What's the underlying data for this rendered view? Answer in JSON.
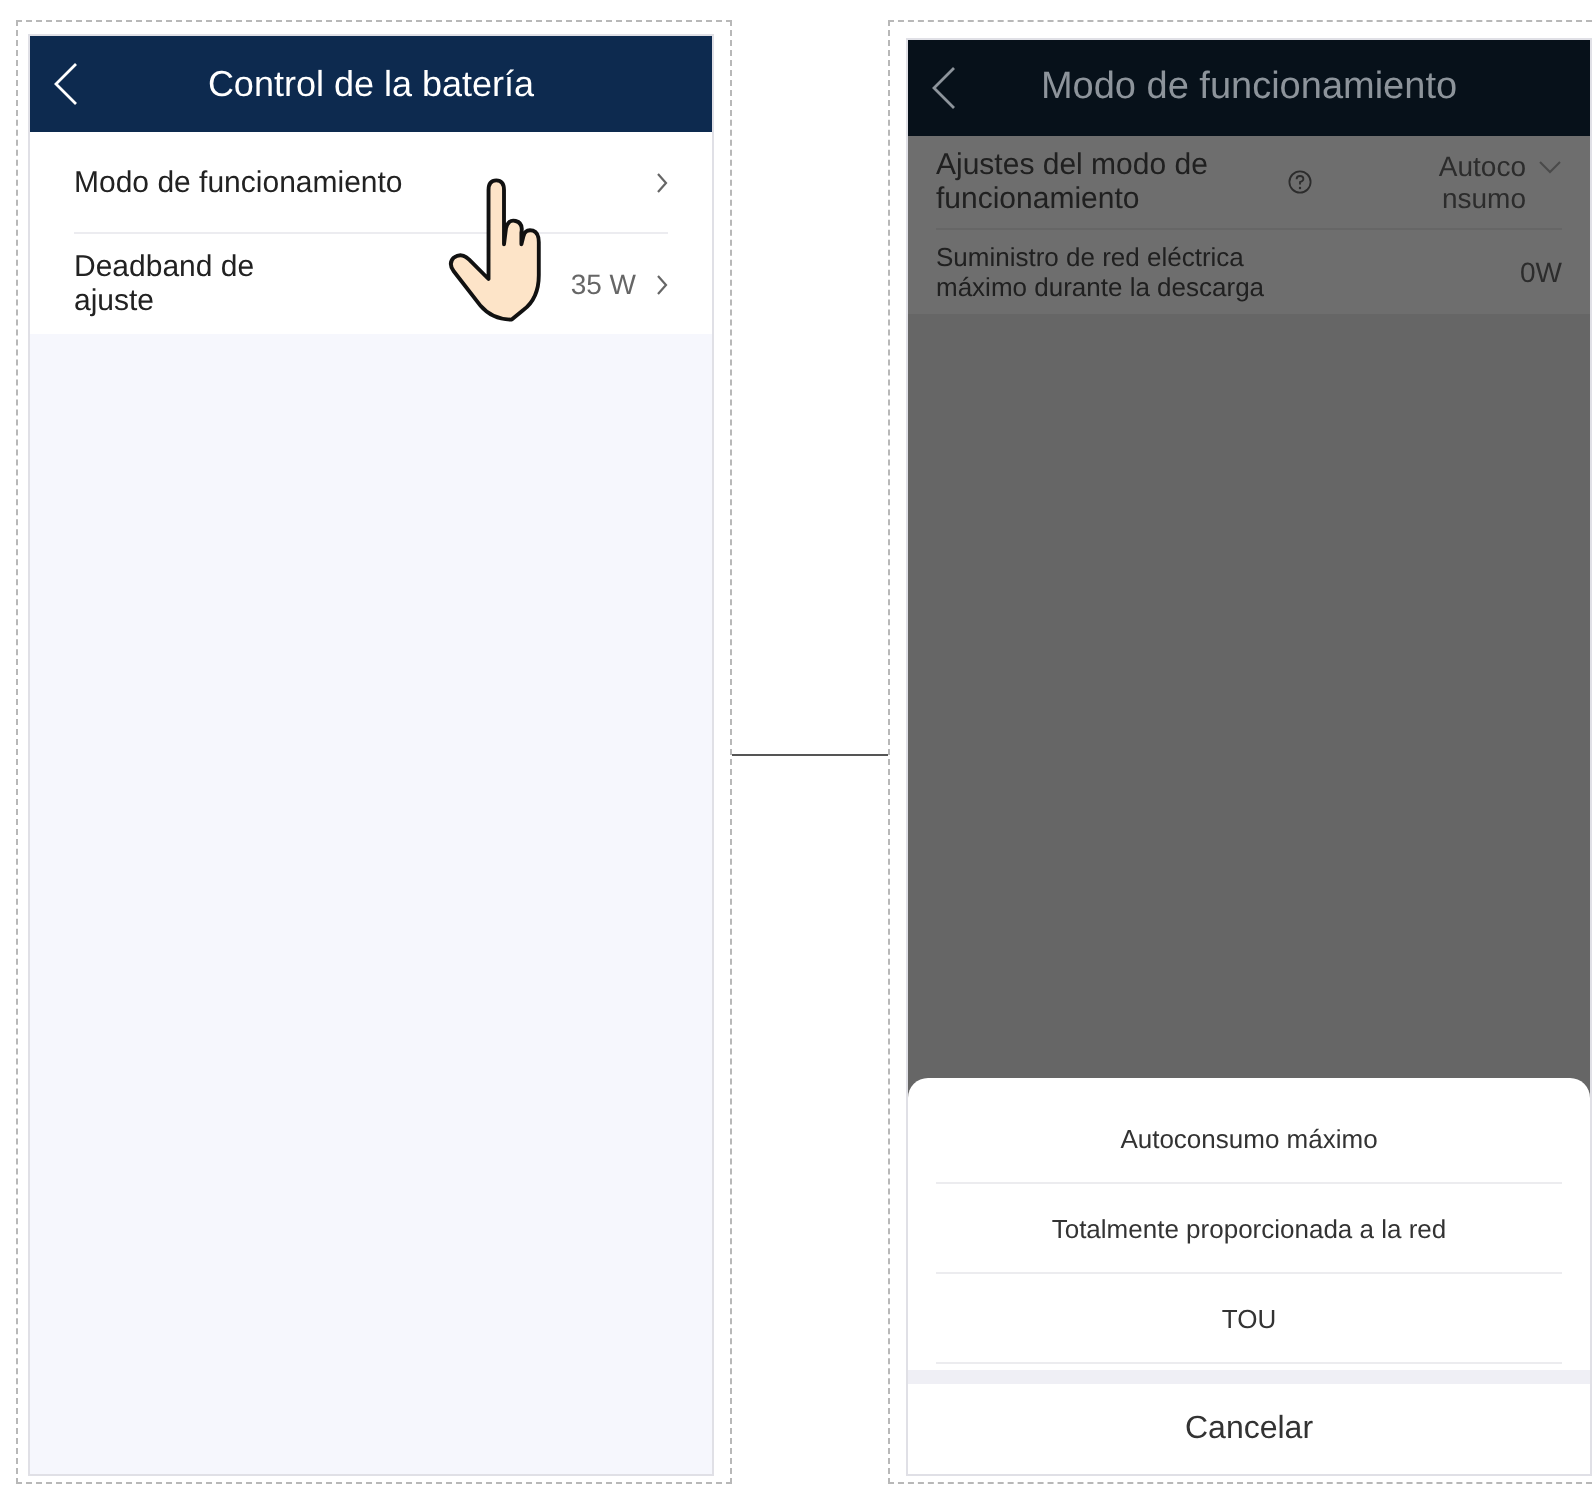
{
  "screens": [
    {
      "title": "Control de la batería",
      "dimmed": false,
      "rows": [
        {
          "kind": "link",
          "label": "Modo de funcionamiento"
        },
        {
          "kind": "link",
          "label": "Deadband de ajuste",
          "value": "35 W"
        }
      ]
    },
    {
      "title": "Modo de funcionamiento",
      "dimmed": true,
      "rows": [
        {
          "kind": "dropdown",
          "label": "Ajustes del modo de funcionamiento",
          "value": "Autoconsumo"
        },
        {
          "kind": "value",
          "label": "Suministro de red eléctrica máximo durante la descarga",
          "value": "0W"
        }
      ],
      "sheet": {
        "options": [
          "Autoconsumo máximo",
          "Totalmente proporcionada a la red",
          "TOU"
        ],
        "cancel": "Cancelar"
      }
    }
  ]
}
